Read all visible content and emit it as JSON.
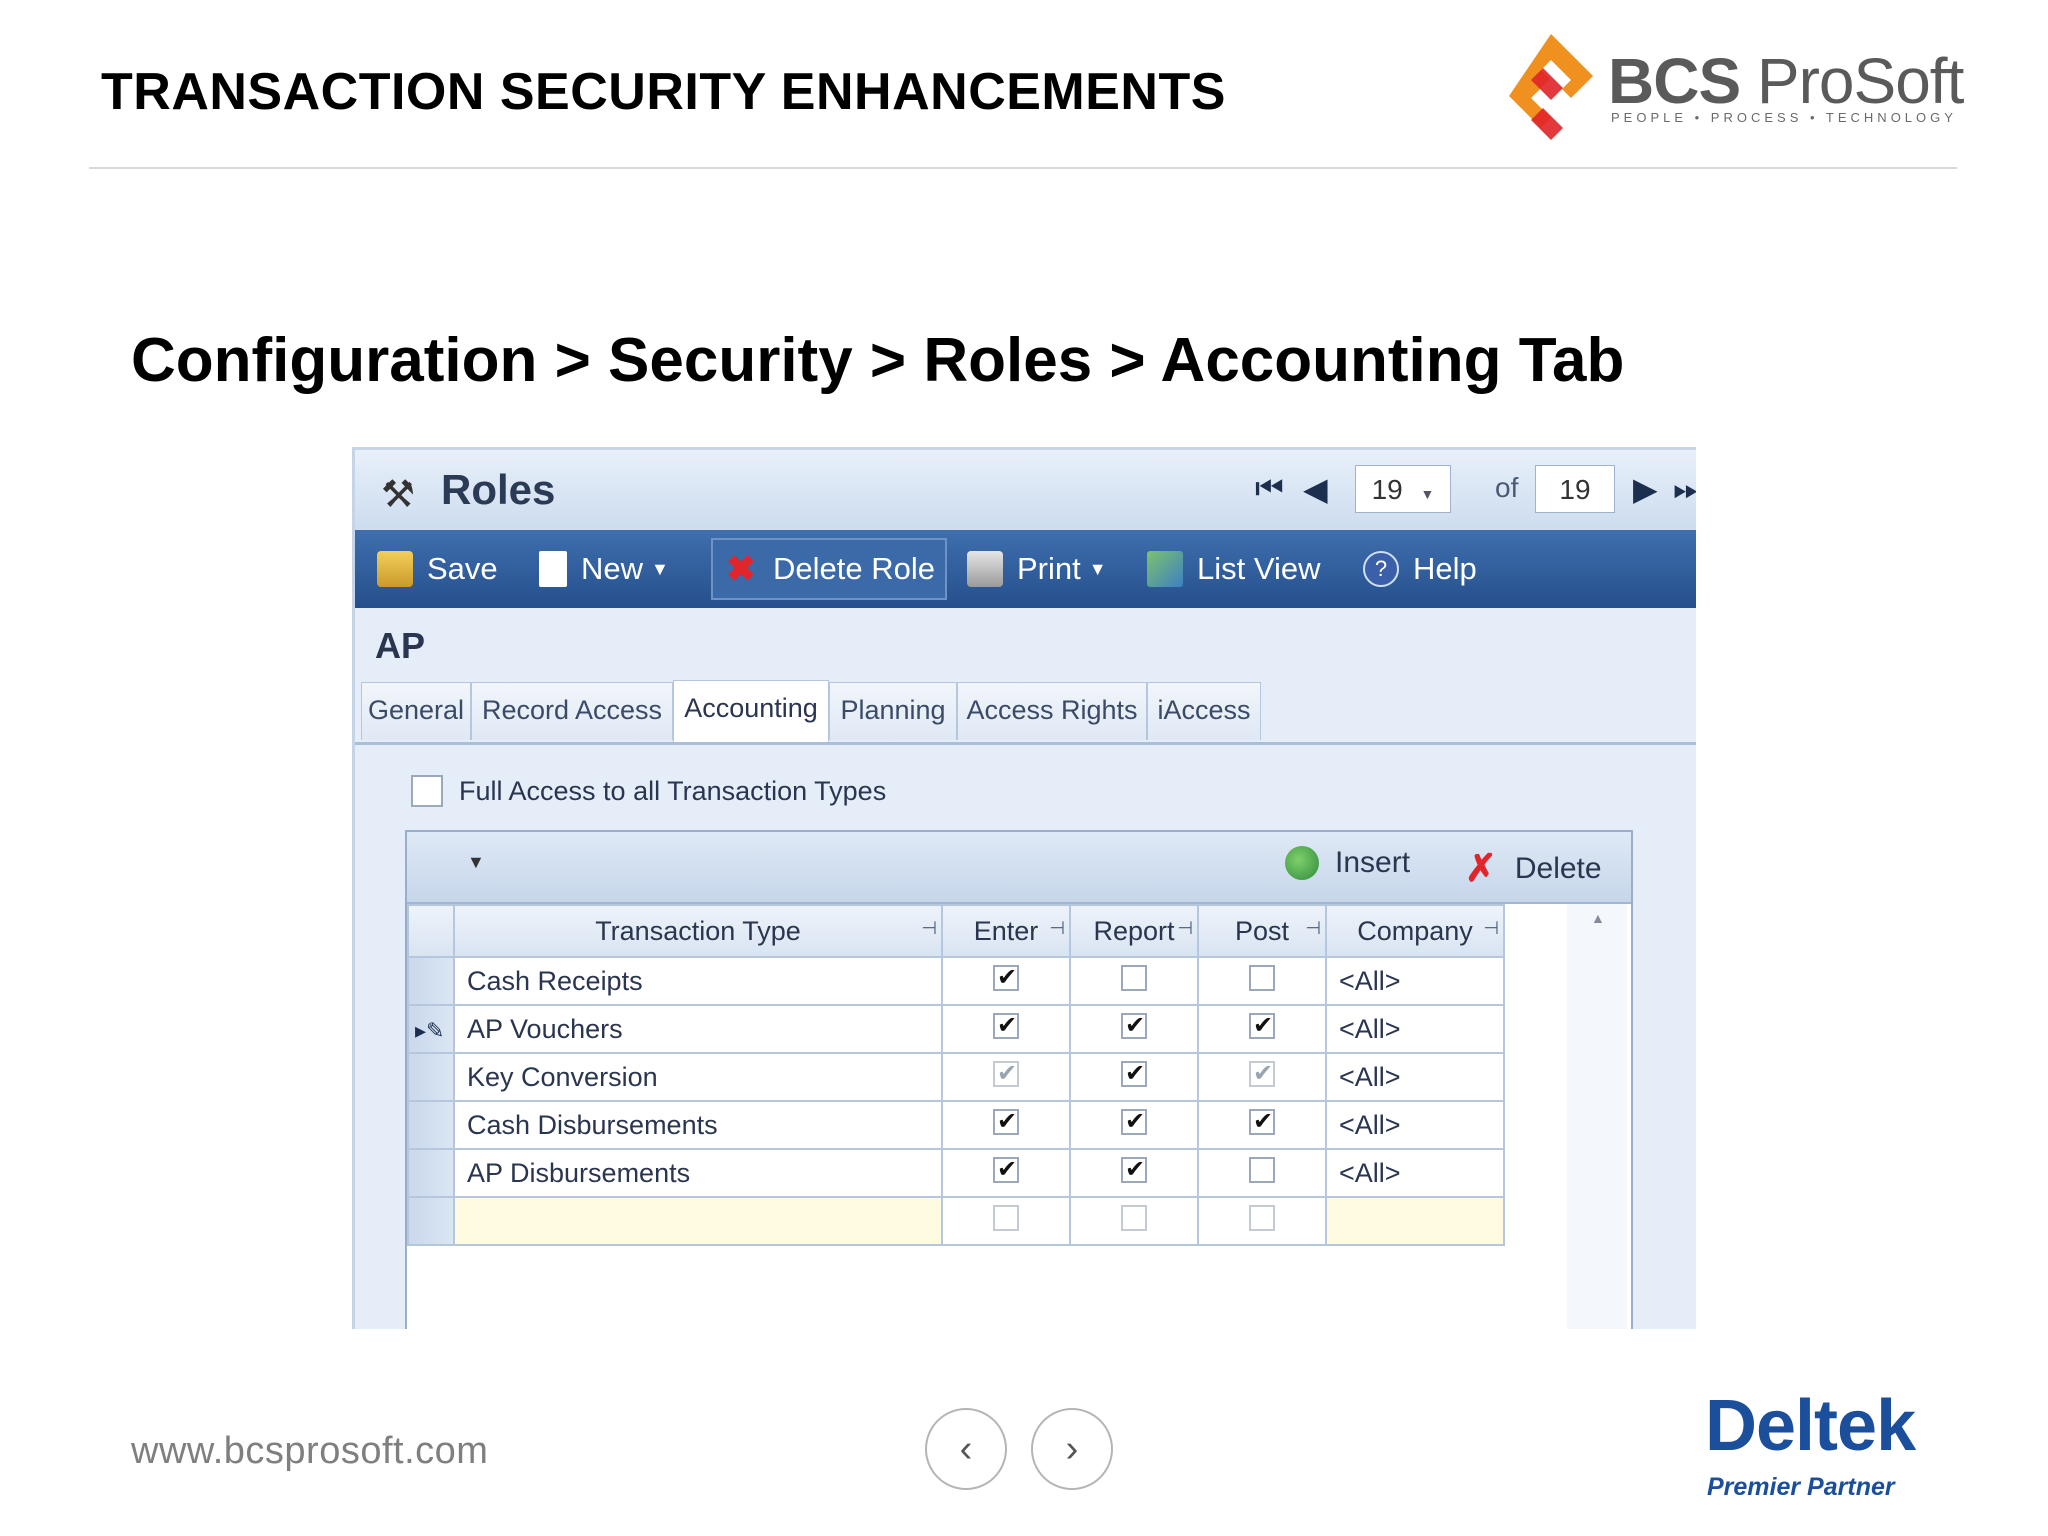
{
  "slide": {
    "title": "TRANSACTION SECURITY ENHANCEMENTS",
    "subtitle": "Configuration > Security > Roles > Accounting Tab",
    "footer_url": "www.bcsprosoft.com",
    "prev_icon": "chevron-left-icon",
    "next_icon": "chevron-right-icon"
  },
  "logo": {
    "name_bold": "BCS",
    "name_light": " ProSoft",
    "tagline": "PEOPLE • PROCESS • TECHNOLOGY",
    "colors": {
      "orange": "#f0901e",
      "red": "#e02427"
    }
  },
  "partner": {
    "name": "Deltek",
    "tagline": "Premier Partner",
    "color": "#1b4f9c"
  },
  "window": {
    "title": "Roles",
    "record_index": "19",
    "of_label": "of",
    "record_total": "19"
  },
  "toolbar": {
    "save": "Save",
    "new": "New",
    "delete_role": "Delete Role",
    "print": "Print",
    "list_view": "List View",
    "help": "Help"
  },
  "record": {
    "name": "AP"
  },
  "tabs": [
    "General",
    "Record Access",
    "Accounting",
    "Planning",
    "Access Rights",
    "iAccess"
  ],
  "active_tab": "Accounting",
  "full_access": {
    "label": "Full Access to all Transaction Types",
    "checked": false
  },
  "grid_toolbar": {
    "insert": "Insert",
    "delete": "Delete"
  },
  "grid": {
    "columns": [
      "Transaction Type",
      "Enter",
      "Report",
      "Post",
      "Company"
    ],
    "rows": [
      {
        "type": "Cash Receipts",
        "enter": true,
        "report": false,
        "post": false,
        "company": "<All>",
        "current": false
      },
      {
        "type": "AP Vouchers",
        "enter": true,
        "report": true,
        "post": true,
        "company": "<All>",
        "current": true
      },
      {
        "type": "Key Conversion",
        "enter": "disabled-checked",
        "report": true,
        "post": "disabled-checked",
        "company": "<All>",
        "current": false
      },
      {
        "type": "Cash Disbursements",
        "enter": true,
        "report": true,
        "post": true,
        "company": "<All>",
        "current": false
      },
      {
        "type": "AP Disbursements",
        "enter": true,
        "report": true,
        "post": false,
        "company": "<All>",
        "current": false
      },
      {
        "type": "",
        "enter": false,
        "report": false,
        "post": false,
        "company": "",
        "current": false,
        "new_row": true
      }
    ]
  }
}
